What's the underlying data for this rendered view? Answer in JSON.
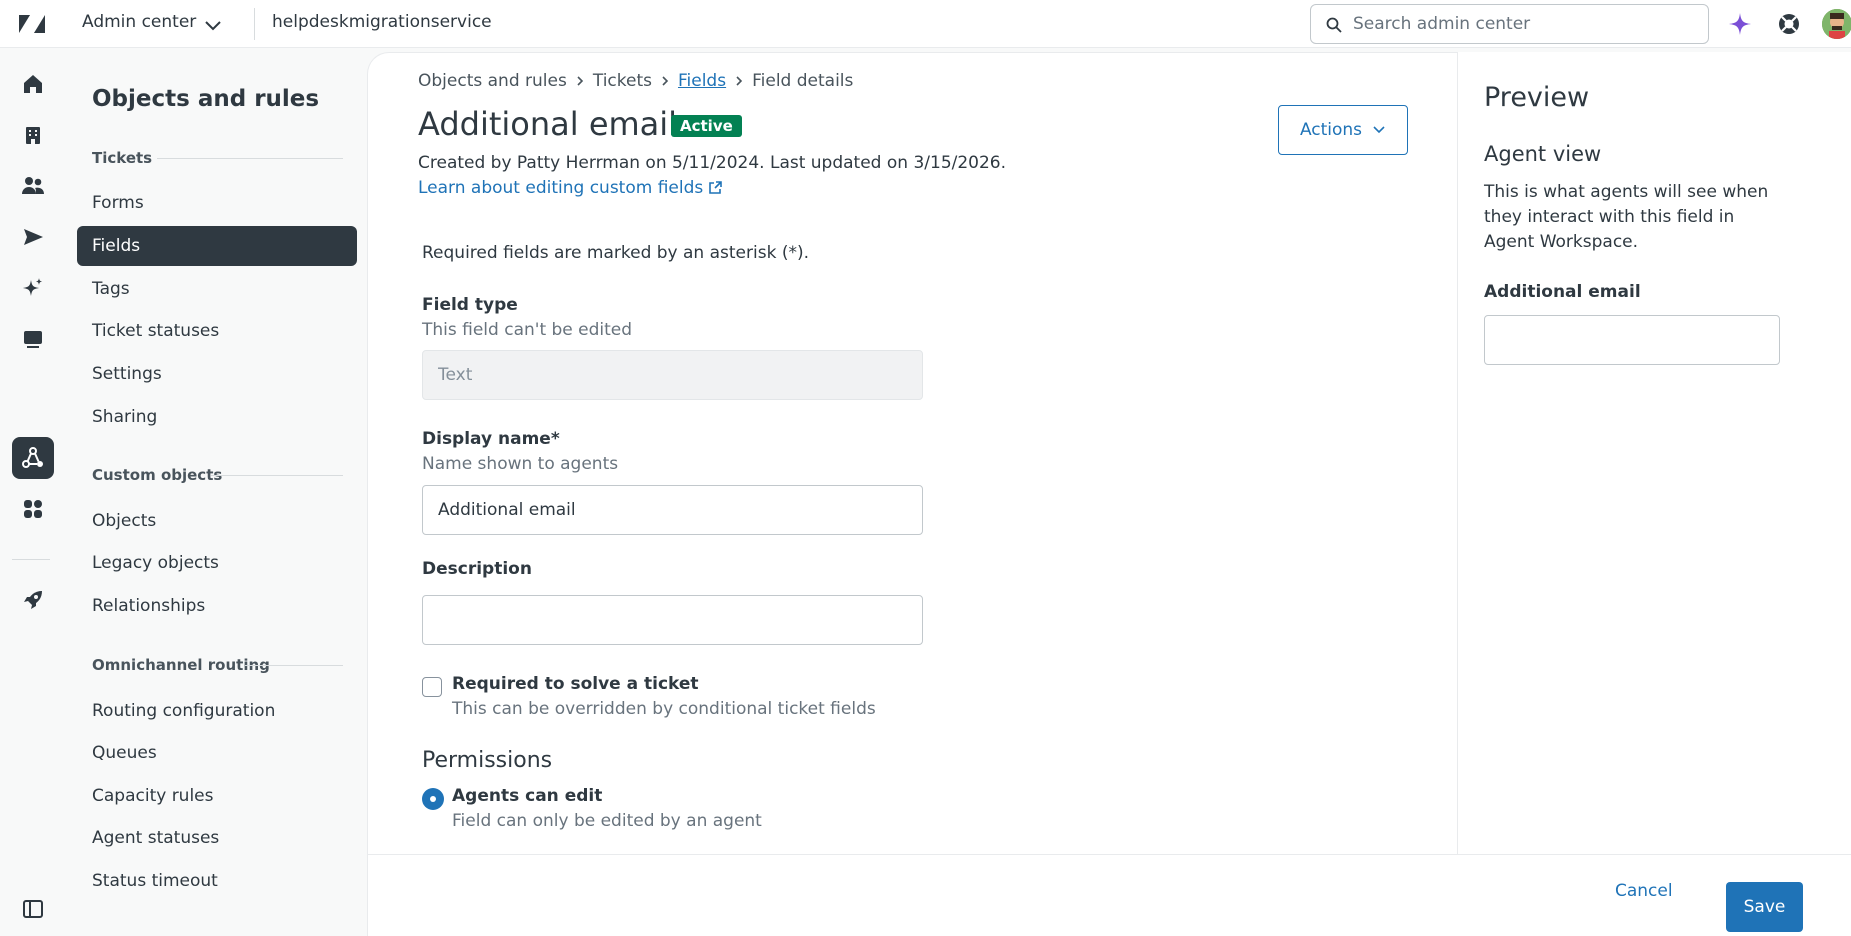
{
  "topbar": {
    "app_name": "Admin center",
    "account": "helpdeskmigrationservice",
    "search_placeholder": "Search admin center"
  },
  "rail": {
    "icons": [
      "home-icon",
      "building-icon",
      "people-icon",
      "send-icon",
      "sparkle-icon",
      "chat-icon",
      "objects-icon",
      "apps-icon",
      "rocket-icon"
    ],
    "active": "objects-icon"
  },
  "nav": {
    "title": "Objects and rules",
    "groups": {
      "tickets": "Tickets",
      "custom_objects": "Custom objects",
      "omnichannel": "Omnichannel routing"
    },
    "items": {
      "forms": "Forms",
      "fields": "Fields",
      "tags": "Tags",
      "ticket_statuses": "Ticket statuses",
      "settings": "Settings",
      "sharing": "Sharing",
      "objects": "Objects",
      "legacy_objects": "Legacy objects",
      "relationships": "Relationships",
      "routing_configuration": "Routing configuration",
      "queues": "Queues",
      "capacity_rules": "Capacity rules",
      "agent_statuses": "Agent statuses",
      "status_timeout": "Status timeout"
    }
  },
  "breadcrumb": {
    "c1": "Objects and rules",
    "c2": "Tickets",
    "c3": "Fields",
    "c4": "Field details"
  },
  "page": {
    "title": "Additional email",
    "status": "Active",
    "meta": "Created by Patty Herrman on 5/11/2024. Last updated on 3/15/2026.",
    "learn_link": "Learn about editing custom fields",
    "actions_label": "Actions"
  },
  "form": {
    "required_note": "Required fields are marked by an asterisk (*).",
    "field_type": {
      "label": "Field type",
      "hint": "This field can't be edited",
      "value": "Text"
    },
    "display_name": {
      "label": "Display name*",
      "hint": "Name shown to agents",
      "value": "Additional email"
    },
    "description": {
      "label": "Description",
      "value": ""
    },
    "required_solve": {
      "label": "Required to solve a ticket",
      "hint": "This can be overridden by conditional ticket fields",
      "checked": false
    },
    "permissions": {
      "heading": "Permissions",
      "option1": {
        "label": "Agents can edit",
        "hint": "Field can only be edited by an agent",
        "selected": true
      }
    }
  },
  "footer": {
    "cancel": "Cancel",
    "save": "Save"
  },
  "preview": {
    "heading": "Preview",
    "subheading": "Agent view",
    "description": "This is what agents will see when they interact with this field in Agent Workspace.",
    "field_label": "Additional email"
  },
  "colors": {
    "accent": "#1f73b7",
    "active_badge": "#038153",
    "nav_active": "#2f3941",
    "ai_icon": "#7b4fd6"
  }
}
